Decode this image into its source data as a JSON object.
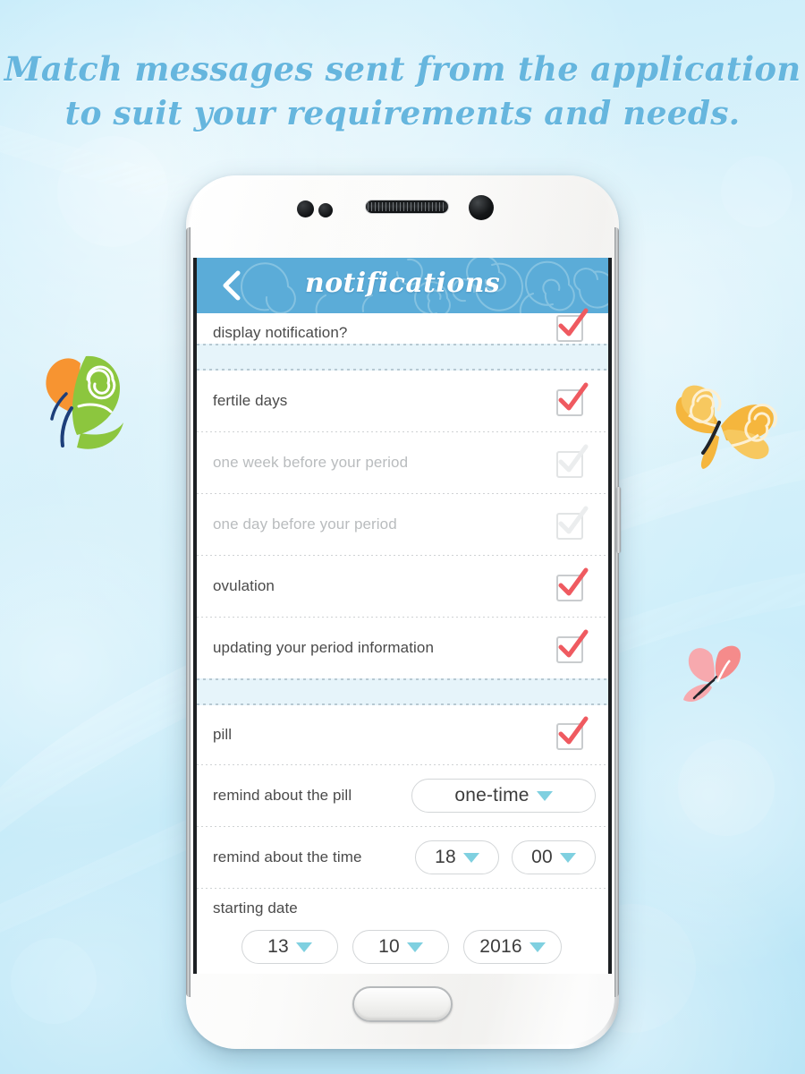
{
  "headline": {
    "line1": "Match messages sent from the application",
    "line2": "to suit your requirements and needs."
  },
  "colors": {
    "header_blue": "#5bacd8",
    "headline_blue": "#66b6de",
    "check_red": "#ef5a60",
    "caret_teal": "#7fd0e0",
    "band_blue": "#e6f4fa",
    "background_blue": "#bfe9f8"
  },
  "phone": {
    "hardware": {
      "earpiece": "speaker-grille",
      "front_camera": "camera-lens",
      "sensor_1": "proximity-sensor",
      "sensor_2": "light-sensor",
      "home_button": "home-button",
      "power_button": "power-button"
    }
  },
  "app": {
    "header": {
      "title": "notifications",
      "back_icon": "chevron-left-icon"
    },
    "rows": [
      {
        "id": "display-notification",
        "label": "display notification?",
        "type": "checkbox",
        "checked": true,
        "enabled": true,
        "clipped": true
      },
      {
        "id": "fertile-days",
        "label": "fertile days",
        "type": "checkbox",
        "checked": true,
        "enabled": true
      },
      {
        "id": "one-week-before-period",
        "label": "one week before your period",
        "type": "checkbox",
        "checked": false,
        "enabled": false
      },
      {
        "id": "one-day-before-period",
        "label": "one day before your period",
        "type": "checkbox",
        "checked": false,
        "enabled": false
      },
      {
        "id": "ovulation",
        "label": "ovulation",
        "type": "checkbox",
        "checked": true,
        "enabled": true
      },
      {
        "id": "updating-period-information",
        "label": "updating your period information",
        "type": "checkbox",
        "checked": true,
        "enabled": true
      },
      {
        "id": "pill",
        "label": "pill",
        "type": "checkbox",
        "checked": true,
        "enabled": true
      }
    ],
    "remind_pill": {
      "label": "remind about the pill",
      "value": "one-time",
      "caret_icon": "chevron-down-icon"
    },
    "remind_time": {
      "label": "remind about the time",
      "hour": "18",
      "minute": "00",
      "caret_icon": "chevron-down-icon"
    },
    "starting_date": {
      "label": "starting date",
      "day": "13",
      "month": "10",
      "year": "2016",
      "caret_icon": "chevron-down-icon"
    }
  },
  "decorations": {
    "butterfly_left": "butterfly-green-orange",
    "butterfly_right": "butterfly-orange",
    "butterfly_pink": "butterfly-pink"
  }
}
